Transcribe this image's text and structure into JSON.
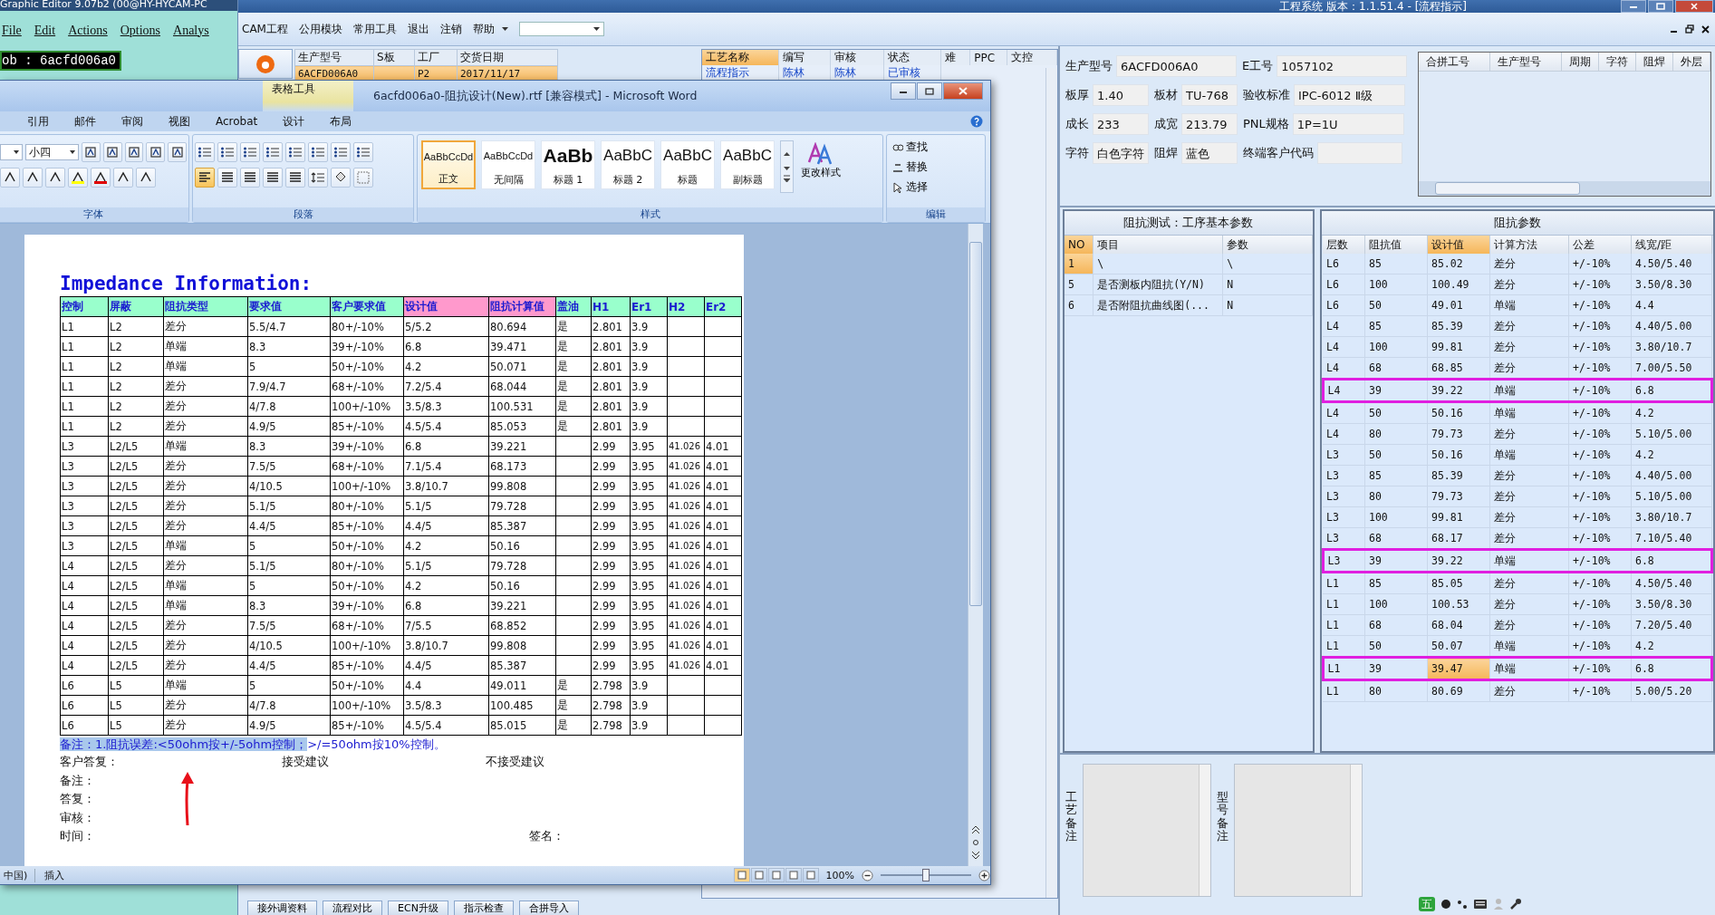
{
  "graphic_editor": {
    "title": "Graphic Editor 9.07b2 (00@HY-HYCAM-PC",
    "menu": [
      "File",
      "Edit",
      "Actions",
      "Options",
      "Analys"
    ],
    "job": "ob : 6acfd006a0"
  },
  "eng_window": {
    "title": "工程系统  版本：1.1.51.4 - [流程指示]",
    "menu": [
      {
        "label": "CAM工程",
        "dropdown": false
      },
      {
        "label": "公用模块",
        "dropdown": false
      },
      {
        "label": "常用工具",
        "dropdown": false
      },
      {
        "label": "退出",
        "dropdown": false
      },
      {
        "label": "注销",
        "dropdown": false
      },
      {
        "label": "帮助",
        "dropdown": true
      }
    ],
    "order_table": {
      "columns": [
        "生产型号",
        "S板",
        "工厂",
        "交货日期"
      ],
      "rows": [
        {
          "cells": [
            "6ACFD006A0",
            null,
            "P2",
            "2017/11/17"
          ],
          "selected": true
        }
      ]
    },
    "process_table": {
      "columns": [
        {
          "label": "工艺名称",
          "selected": true
        },
        {
          "label": "编写",
          "selected": false
        },
        {
          "label": "审核",
          "selected": false
        },
        {
          "label": "状态",
          "selected": false
        },
        {
          "label": "难",
          "selected": false
        },
        {
          "label": "PPC",
          "selected": false
        },
        {
          "label": "文控",
          "selected": false
        }
      ],
      "rows": [
        {
          "cells": [
            "流程指示",
            "陈林",
            "陈林",
            "已审核"
          ]
        }
      ]
    },
    "bottom_buttons": [
      "接外调资料",
      "流程对比",
      "ECN升级",
      "指示检查",
      "合拼导入"
    ]
  },
  "info": {
    "fields": [
      {
        "label": "生产型号",
        "value": "6ACFD006A0"
      },
      {
        "label": "E工号",
        "value": "1057102"
      },
      {
        "label": "板厚",
        "value": "1.40"
      },
      {
        "label": "板材",
        "value": "TU-768"
      },
      {
        "label": "验收标准",
        "value": "IPC-6012 Ⅱ级"
      },
      {
        "label": "成长",
        "value": "233"
      },
      {
        "label": "成宽",
        "value": "213.79"
      },
      {
        "label": "PNL规格",
        "value": "1P=1U"
      },
      {
        "label": "字符",
        "value": "白色字符"
      },
      {
        "label": "阻焊",
        "value": "蓝色"
      },
      {
        "label": "终端客户代码"
      }
    ]
  },
  "merge_table": {
    "columns": [
      "合拼工号",
      "生产型号",
      "周期",
      "字符",
      "阻焊",
      "外层"
    ]
  },
  "test_panel": {
    "title": "阻抗测试：工序基本参数",
    "columns": [
      {
        "label": "NO",
        "selected": true
      },
      {
        "label": "项目",
        "selected": false
      },
      {
        "label": "参数",
        "selected": false
      }
    ],
    "rows": [
      {
        "no": "1",
        "item": "\\",
        "param": "\\",
        "selected": true
      },
      {
        "no": "5",
        "item": "是否测板内阻抗(Y/N)",
        "param": "N",
        "selected": false
      },
      {
        "no": "6",
        "item": "是否附阻抗曲线图(...",
        "param": "N",
        "selected": false
      }
    ]
  },
  "impedance_panel": {
    "title": "阻抗参数",
    "columns": [
      {
        "label": "层数",
        "selected": false
      },
      {
        "label": "阻抗值",
        "selected": false
      },
      {
        "label": "设计值",
        "selected": true
      },
      {
        "label": "计算方法",
        "selected": false
      },
      {
        "label": "公差",
        "selected": false
      },
      {
        "label": "线宽/距",
        "selected": false
      }
    ],
    "rows": [
      {
        "cells": [
          "L6",
          "85",
          "85.02",
          "差分",
          "+/-10%",
          "4.50/5.40"
        ],
        "marked": false,
        "selected": false
      },
      {
        "cells": [
          "L6",
          "100",
          "100.49",
          "差分",
          "+/-10%",
          "3.50/8.30"
        ],
        "marked": false,
        "selected": false
      },
      {
        "cells": [
          "L6",
          "50",
          "49.01",
          "单端",
          "+/-10%",
          "4.4"
        ],
        "marked": false,
        "selected": false
      },
      {
        "cells": [
          "L4",
          "85",
          "85.39",
          "差分",
          "+/-10%",
          "4.40/5.00"
        ],
        "marked": false,
        "selected": false
      },
      {
        "cells": [
          "L4",
          "100",
          "99.81",
          "差分",
          "+/-10%",
          "3.80/10.7"
        ],
        "marked": false,
        "selected": false
      },
      {
        "cells": [
          "L4",
          "68",
          "68.85",
          "差分",
          "+/-10%",
          "7.00/5.50"
        ],
        "marked": false,
        "selected": false
      },
      {
        "cells": [
          "L4",
          "39",
          "39.22",
          "单端",
          "+/-10%",
          "6.8"
        ],
        "marked": true,
        "selected": false
      },
      {
        "cells": [
          "L4",
          "50",
          "50.16",
          "单端",
          "+/-10%",
          "4.2"
        ],
        "marked": false,
        "selected": false
      },
      {
        "cells": [
          "L4",
          "80",
          "79.73",
          "差分",
          "+/-10%",
          "5.10/5.00"
        ],
        "marked": false,
        "selected": false
      },
      {
        "cells": [
          "L3",
          "50",
          "50.16",
          "单端",
          "+/-10%",
          "4.2"
        ],
        "marked": false,
        "selected": false
      },
      {
        "cells": [
          "L3",
          "85",
          "85.39",
          "差分",
          "+/-10%",
          "4.40/5.00"
        ],
        "marked": false,
        "selected": false
      },
      {
        "cells": [
          "L3",
          "80",
          "79.73",
          "差分",
          "+/-10%",
          "5.10/5.00"
        ],
        "marked": false,
        "selected": false
      },
      {
        "cells": [
          "L3",
          "100",
          "99.81",
          "差分",
          "+/-10%",
          "3.80/10.7"
        ],
        "marked": false,
        "selected": false
      },
      {
        "cells": [
          "L3",
          "68",
          "68.17",
          "差分",
          "+/-10%",
          "7.10/5.40"
        ],
        "marked": false,
        "selected": false
      },
      {
        "cells": [
          "L3",
          "39",
          "39.22",
          "单端",
          "+/-10%",
          "6.8"
        ],
        "marked": true,
        "selected": false
      },
      {
        "cells": [
          "L1",
          "85",
          "85.05",
          "差分",
          "+/-10%",
          "4.50/5.40"
        ],
        "marked": false,
        "selected": false
      },
      {
        "cells": [
          "L1",
          "100",
          "100.53",
          "差分",
          "+/-10%",
          "3.50/8.30"
        ],
        "marked": false,
        "selected": false
      },
      {
        "cells": [
          "L1",
          "68",
          "68.04",
          "差分",
          "+/-10%",
          "7.20/5.40"
        ],
        "marked": false,
        "selected": false
      },
      {
        "cells": [
          "L1",
          "50",
          "50.07",
          "单端",
          "+/-10%",
          "4.2"
        ],
        "marked": false,
        "selected": false
      },
      {
        "cells": [
          "L1",
          "39",
          "39.47",
          "单端",
          "+/-10%",
          "6.8"
        ],
        "marked": true,
        "selected": true
      },
      {
        "cells": [
          "L1",
          "80",
          "80.69",
          "差分",
          "+/-10%",
          "5.00/5.20"
        ],
        "marked": false,
        "selected": false
      }
    ]
  },
  "remarks": [
    {
      "label": "工艺备注"
    },
    {
      "label": "型号备注"
    }
  ],
  "tray": {
    "ime": "五"
  },
  "word": {
    "title": "6acfd006a0-阻抗设计(New).rtf [兼容模式] - Microsoft Word",
    "context_tab": "表格工具",
    "tabs": [
      "引用",
      "邮件",
      "审阅",
      "视图",
      "Acrobat",
      "设计",
      "布局"
    ],
    "font_size": "小四",
    "alignment_buttons": [
      {
        "selected": true
      },
      {
        "selected": false
      },
      {
        "selected": false
      },
      {
        "selected": false
      },
      {
        "selected": false
      }
    ],
    "styles": [
      {
        "preview": "AaBbCcDd",
        "name": "正文",
        "kind": "small",
        "selected": true
      },
      {
        "preview": "AaBbCcDd",
        "name": "无间隔",
        "kind": "small",
        "selected": false
      },
      {
        "preview": "AaBb",
        "name": "标题 1",
        "kind": "large",
        "selected": false
      },
      {
        "preview": "AaBbC",
        "name": "标题 2",
        "kind": "medium",
        "selected": false
      },
      {
        "preview": "AaBbC",
        "name": "标题",
        "kind": "medium",
        "selected": false
      },
      {
        "preview": "AaBbC",
        "name": "副标题",
        "kind": "medium",
        "selected": false
      }
    ],
    "change_styles": "更改样式",
    "edit_buttons": [
      "查找",
      "替换",
      "选择"
    ],
    "groups": [
      "字体",
      "段落",
      "样式",
      "编辑"
    ],
    "doc": {
      "heading": "Impedance Information:",
      "columns": [
        {
          "label": "控制",
          "color": "#99ffcc"
        },
        {
          "label": "屏蔽",
          "color": "#99ffcc"
        },
        {
          "label": "阻抗类型",
          "color": "#99ffcc"
        },
        {
          "label": "要求值",
          "color": "#99ffcc"
        },
        {
          "label": "客户要求值",
          "color": "#99ffcc"
        },
        {
          "label": "设计值",
          "color": "#ff99cc"
        },
        {
          "label": "阻抗计算值",
          "color": "#ff99cc"
        },
        {
          "label": "盖油",
          "color": "#99ffcc"
        },
        {
          "label": "H1",
          "color": "#99ffcc"
        },
        {
          "label": "Er1",
          "color": "#99ffcc"
        },
        {
          "label": "H2",
          "color": "#99ffcc"
        },
        {
          "label": "Er2",
          "color": "#99ffcc"
        }
      ],
      "rows": [
        [
          "L1",
          "L2",
          "差分",
          "5.5/4.7",
          "80+/-10%",
          "5/5.2",
          "80.694",
          "是",
          "2.801",
          "3.9"
        ],
        [
          "L1",
          "L2",
          "单端",
          "8.3",
          "39+/-10%",
          "6.8",
          "39.471",
          "是",
          "2.801",
          "3.9"
        ],
        [
          "L1",
          "L2",
          "单端",
          "5",
          "50+/-10%",
          "4.2",
          "50.071",
          "是",
          "2.801",
          "3.9"
        ],
        [
          "L1",
          "L2",
          "差分",
          "7.9/4.7",
          "68+/-10%",
          "7.2/5.4",
          "68.044",
          "是",
          "2.801",
          "3.9"
        ],
        [
          "L1",
          "L2",
          "差分",
          "4/7.8",
          "100+/-10%",
          "3.5/8.3",
          "100.531",
          "是",
          "2.801",
          "3.9"
        ],
        [
          "L1",
          "L2",
          "差分",
          "4.9/5",
          "85+/-10%",
          "4.5/5.4",
          "85.053",
          "是",
          "2.801",
          "3.9"
        ],
        [
          "L3",
          "L2/L5",
          "单端",
          "8.3",
          "39+/-10%",
          "6.8",
          "39.221",
          null,
          "2.99",
          "3.95",
          "41.026",
          "4.01"
        ],
        [
          "L3",
          "L2/L5",
          "差分",
          "7.5/5",
          "68+/-10%",
          "7.1/5.4",
          "68.173",
          null,
          "2.99",
          "3.95",
          "41.026",
          "4.01"
        ],
        [
          "L3",
          "L2/L5",
          "差分",
          "4/10.5",
          "100+/-10%",
          "3.8/10.7",
          "99.808",
          null,
          "2.99",
          "3.95",
          "41.026",
          "4.01"
        ],
        [
          "L3",
          "L2/L5",
          "差分",
          "5.1/5",
          "80+/-10%",
          "5.1/5",
          "79.728",
          null,
          "2.99",
          "3.95",
          "41.026",
          "4.01"
        ],
        [
          "L3",
          "L2/L5",
          "差分",
          "4.4/5",
          "85+/-10%",
          "4.4/5",
          "85.387",
          null,
          "2.99",
          "3.95",
          "41.026",
          "4.01"
        ],
        [
          "L3",
          "L2/L5",
          "单端",
          "5",
          "50+/-10%",
          "4.2",
          "50.16",
          null,
          "2.99",
          "3.95",
          "41.026",
          "4.01"
        ],
        [
          "L4",
          "L2/L5",
          "差分",
          "5.1/5",
          "80+/-10%",
          "5.1/5",
          "79.728",
          null,
          "2.99",
          "3.95",
          "41.026",
          "4.01"
        ],
        [
          "L4",
          "L2/L5",
          "单端",
          "5",
          "50+/-10%",
          "4.2",
          "50.16",
          null,
          "2.99",
          "3.95",
          "41.026",
          "4.01"
        ],
        [
          "L4",
          "L2/L5",
          "单端",
          "8.3",
          "39+/-10%",
          "6.8",
          "39.221",
          null,
          "2.99",
          "3.95",
          "41.026",
          "4.01"
        ],
        [
          "L4",
          "L2/L5",
          "差分",
          "7.5/5",
          "68+/-10%",
          "7/5.5",
          "68.852",
          null,
          "2.99",
          "3.95",
          "41.026",
          "4.01"
        ],
        [
          "L4",
          "L2/L5",
          "差分",
          "4/10.5",
          "100+/-10%",
          "3.8/10.7",
          "99.808",
          null,
          "2.99",
          "3.95",
          "41.026",
          "4.01"
        ],
        [
          "L4",
          "L2/L5",
          "差分",
          "4.4/5",
          "85+/-10%",
          "4.4/5",
          "85.387",
          null,
          "2.99",
          "3.95",
          "41.026",
          "4.01"
        ],
        [
          "L6",
          "L5",
          "单端",
          "5",
          "50+/-10%",
          "4.4",
          "49.011",
          "是",
          "2.798",
          "3.9"
        ],
        [
          "L6",
          "L5",
          "差分",
          "4/7.8",
          "100+/-10%",
          "3.5/8.3",
          "100.485",
          "是",
          "2.798",
          "3.9"
        ],
        [
          "L6",
          "L5",
          "差分",
          "4.9/5",
          "85+/-10%",
          "4.5/5.4",
          "85.015",
          "是",
          "2.798",
          "3.9"
        ]
      ],
      "note": {
        "selected_text": "备注：1.阻抗误差:<50ohm按+/-5ohm控制；",
        "text": ">/=50ohm按10%控制。"
      },
      "reply": {
        "label": "客户答复：",
        "accept": "接受建议",
        "reject": "不接受建议"
      },
      "lines": [
        "备注：",
        "答复：",
        "审核："
      ],
      "time": "时间：",
      "signature": "签名："
    },
    "status": {
      "language": "中国)",
      "mode": "插入",
      "zoom": "100%",
      "level": 0.5
    }
  }
}
